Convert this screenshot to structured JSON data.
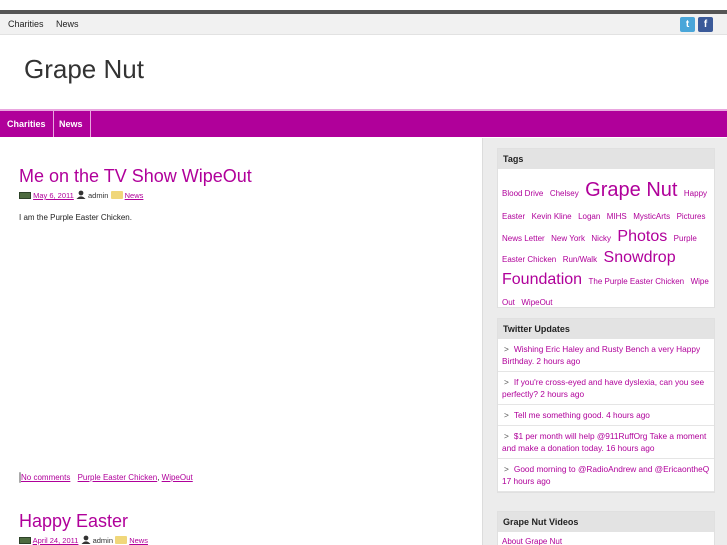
{
  "top_nav": {
    "items": [
      "Charities",
      "News"
    ]
  },
  "social": {
    "twitter": "t",
    "facebook": "f"
  },
  "site_title": "Grape Nut",
  "main_nav": {
    "items": [
      "Charities",
      "News"
    ]
  },
  "posts": [
    {
      "title": "Me on the TV Show WipeOut",
      "date": "May 6, 2011",
      "author": "admin",
      "category": "News",
      "excerpt": "I am the Purple Easter Chicken.",
      "comments": "No comments",
      "tags": [
        "Purple Easter Chicken",
        "WipeOut"
      ]
    },
    {
      "title": "Happy Easter",
      "date": "April 24, 2011",
      "author": "admin",
      "category": "News"
    }
  ],
  "sidebar": {
    "tags_title": "Tags",
    "tags": [
      {
        "label": "Blood Drive",
        "size": 8
      },
      {
        "label": "Chelsey",
        "size": 8
      },
      {
        "label": "Grape Nut",
        "size": 20
      },
      {
        "label": "Happy Easter",
        "size": 8
      },
      {
        "label": "Kevin Kline",
        "size": 8
      },
      {
        "label": "Logan",
        "size": 8
      },
      {
        "label": "MIHS",
        "size": 8
      },
      {
        "label": "MysticArts",
        "size": 8
      },
      {
        "label": "Pictures",
        "size": 8
      },
      {
        "label": "News Letter",
        "size": 8
      },
      {
        "label": "New York",
        "size": 8
      },
      {
        "label": "Nicky",
        "size": 8
      },
      {
        "label": "Photos",
        "size": 16
      },
      {
        "label": "Purple Easter Chicken",
        "size": 8
      },
      {
        "label": "Run/Walk",
        "size": 8
      },
      {
        "label": "Snowdrop Foundation",
        "size": 16
      },
      {
        "label": "The Purple Easter Chicken",
        "size": 8
      },
      {
        "label": "Wipe Out",
        "size": 8
      },
      {
        "label": "WipeOut",
        "size": 8
      }
    ],
    "twitter_title": "Twitter Updates",
    "tweets": [
      "Wishing Eric Haley and Rusty Bench a very Happy Birthday. 2 hours ago",
      "If you're cross-eyed and have dyslexia, can you see perfectly? 2 hours ago",
      "Tell me something good. 4 hours ago",
      "$1 per month will help @911RuffOrg Take a moment and make a donation today. 16 hours ago",
      "Good morning to @RadioAndrew and @EricaontheQ 17 hours ago"
    ],
    "videos_title": "Grape Nut Videos",
    "videos_link": "About Grape Nut"
  },
  "colors": {
    "accent": "#b0009a",
    "sidebar_bg": "#ececec"
  }
}
